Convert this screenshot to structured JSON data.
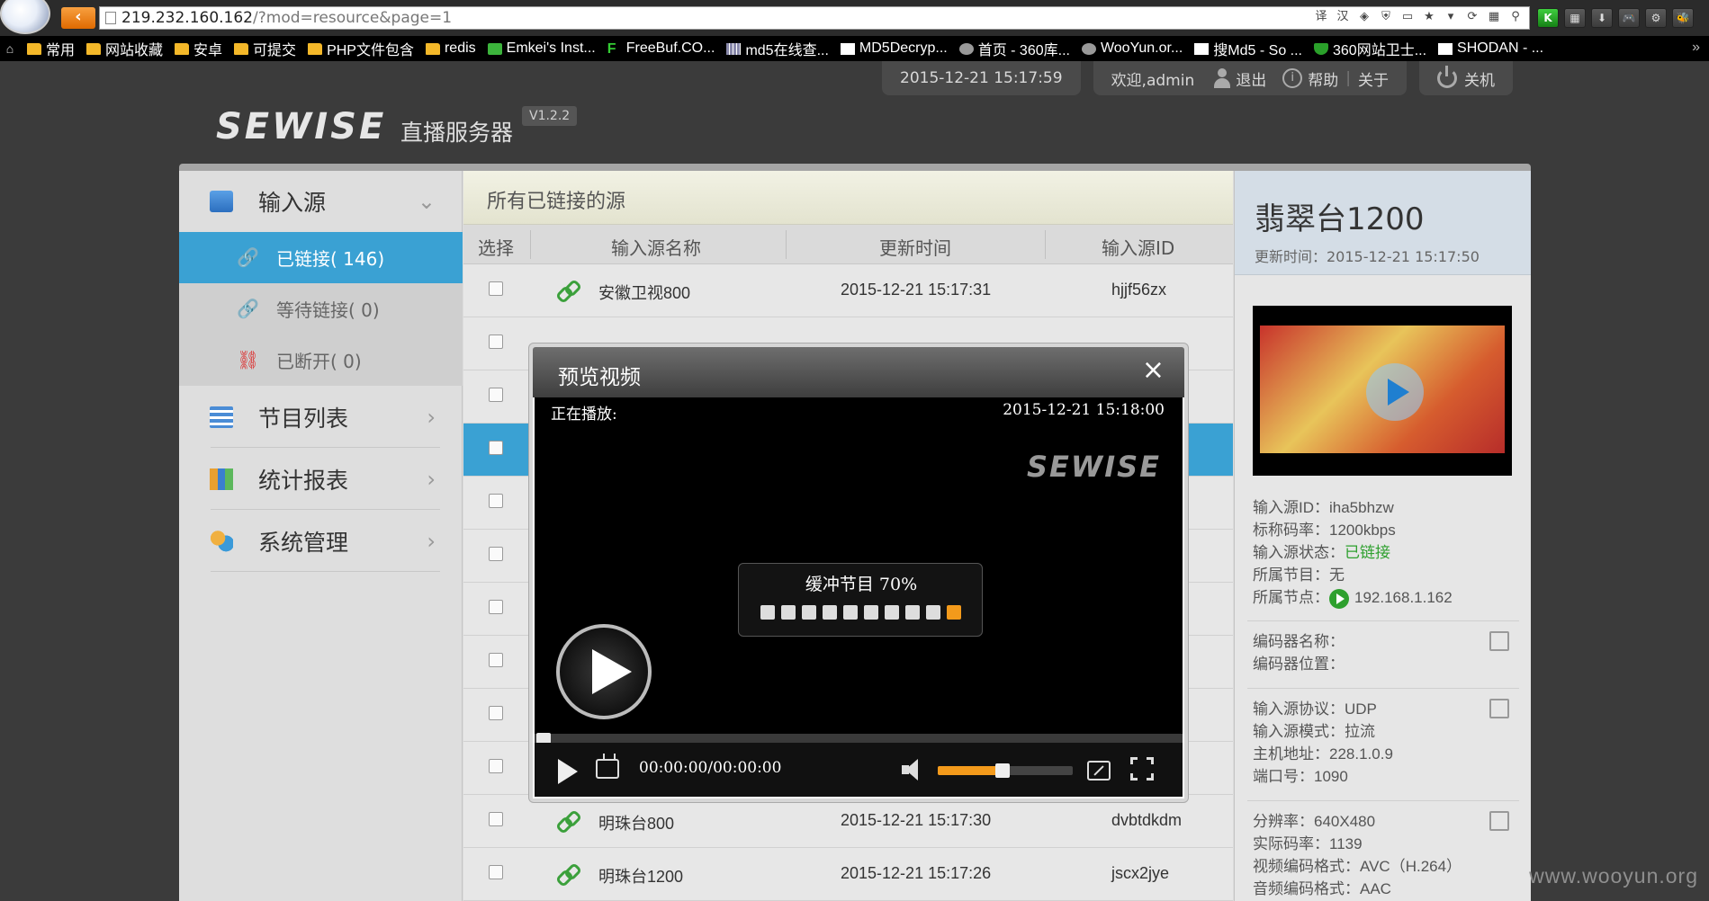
{
  "browser": {
    "url_host": "219.232.160.162",
    "url_rest": "/?mod=resource&page=1",
    "url_tool_icons": [
      "translate-icon",
      "chinese-icon",
      "search-engine-icon",
      "shield-icon",
      "page-icon",
      "star-icon",
      "menu-icon",
      "refresh-icon",
      "site-icon",
      "search-icon"
    ],
    "extensions": [
      "K",
      "▦",
      "⬇",
      "🎮",
      "⚙",
      "🐝"
    ],
    "bookmarks": [
      {
        "label": "常用",
        "icon": "folder"
      },
      {
        "label": "网站收藏",
        "icon": "folder"
      },
      {
        "label": "安卓",
        "icon": "folder"
      },
      {
        "label": "可提交",
        "icon": "folder"
      },
      {
        "label": "PHP文件包含",
        "icon": "folder"
      },
      {
        "label": "redis",
        "icon": "folder"
      },
      {
        "label": "Emkei's Inst...",
        "icon": "green"
      },
      {
        "label": "FreeBuf.CO...",
        "icon": "fgreen"
      },
      {
        "label": "md5在线查...",
        "icon": "grid"
      },
      {
        "label": "MD5Decryp...",
        "icon": "page"
      },
      {
        "label": "首页 - 360库...",
        "icon": "round"
      },
      {
        "label": "WooYun.or...",
        "icon": "round"
      },
      {
        "label": "搜Md5 - So ...",
        "icon": "page"
      },
      {
        "label": "360网站卫士...",
        "icon": "shield"
      },
      {
        "label": "SHODAN - ...",
        "icon": "page"
      }
    ]
  },
  "header": {
    "datetime": "2015-12-21 15:17:59",
    "welcome": "欢迎,admin",
    "logout": "退出",
    "help": "帮助",
    "about": "关于",
    "shutdown": "关机",
    "brand_logo": "SEWISE",
    "brand_title": "直播服务器",
    "version": "V1.2.2"
  },
  "sidebar": {
    "input_source": "输入源",
    "sub_items": [
      {
        "label": "已链接( 146)",
        "active": true,
        "icon_color": "#ffffff",
        "icon": "🔗"
      },
      {
        "label": "等待链接( 0)",
        "active": false,
        "icon_color": "#f0a030",
        "icon": "🔗"
      },
      {
        "label": "已断开( 0)",
        "active": false,
        "icon_color": "#d22",
        "icon": "⛓"
      }
    ],
    "program_list": "节目列表",
    "stats_report": "统计报表",
    "system_mgmt": "系统管理"
  },
  "content": {
    "title": "所有已链接的源",
    "columns": {
      "select": "选择",
      "name": "输入源名称",
      "time": "更新时间",
      "id": "输入源ID"
    },
    "rows": [
      {
        "name": "安徽卫视800",
        "time": "2015-12-21 15:17:31",
        "id": "hjjf56zx"
      },
      {
        "name": "",
        "time": "",
        "id": ""
      },
      {
        "name": "",
        "time": "",
        "id": ""
      },
      {
        "name": "",
        "time": "",
        "id": "",
        "selected": true
      },
      {
        "name": "",
        "time": "",
        "id": ""
      },
      {
        "name": "",
        "time": "",
        "id": ""
      },
      {
        "name": "",
        "time": "",
        "id": ""
      },
      {
        "name": "",
        "time": "",
        "id": ""
      },
      {
        "name": "",
        "time": "",
        "id": ""
      },
      {
        "name": "",
        "time": "",
        "id": ""
      },
      {
        "name": "明珠台800",
        "time": "2015-12-21 15:17:30",
        "id": "dvbtdkdm"
      },
      {
        "name": "明珠台1200",
        "time": "2015-12-21 15:17:26",
        "id": "jscx2jye"
      }
    ]
  },
  "detail": {
    "title": "翡翠台1200",
    "updated": "更新时间：2015-12-21 15:17:50",
    "group1": [
      "输入源ID：iha5bhzw",
      "标称码率：1200kbps"
    ],
    "status_label": "输入源状态：",
    "status_value": "已链接",
    "program": "所属节目：无",
    "node_label": "所属节点：",
    "node_value": "192.168.1.162",
    "group2": [
      "编码器名称：",
      "编码器位置："
    ],
    "group3": [
      "输入源协议：UDP",
      "输入源模式：拉流",
      "主机地址：228.1.0.9",
      "端口号：1090"
    ],
    "group4": [
      "分辨率：640X480",
      "实际码率：1139",
      "视频编码格式：AVC（H.264）",
      "音频编码格式：AAC"
    ]
  },
  "modal": {
    "title": "预览视频",
    "close": "×",
    "now_playing": "正在播放:",
    "play_time": "2015-12-21  15:18:00",
    "watermark": "SEWISE",
    "buffer_text": "缓冲节目  70%",
    "buffer_total_dots": 10,
    "buffer_active_index": 9,
    "elapsed_time": "00:00:00/00:00:00",
    "volume_fraction": 0.48,
    "accent": "#f39a1b"
  },
  "site_watermark": "www.wooyun.org"
}
